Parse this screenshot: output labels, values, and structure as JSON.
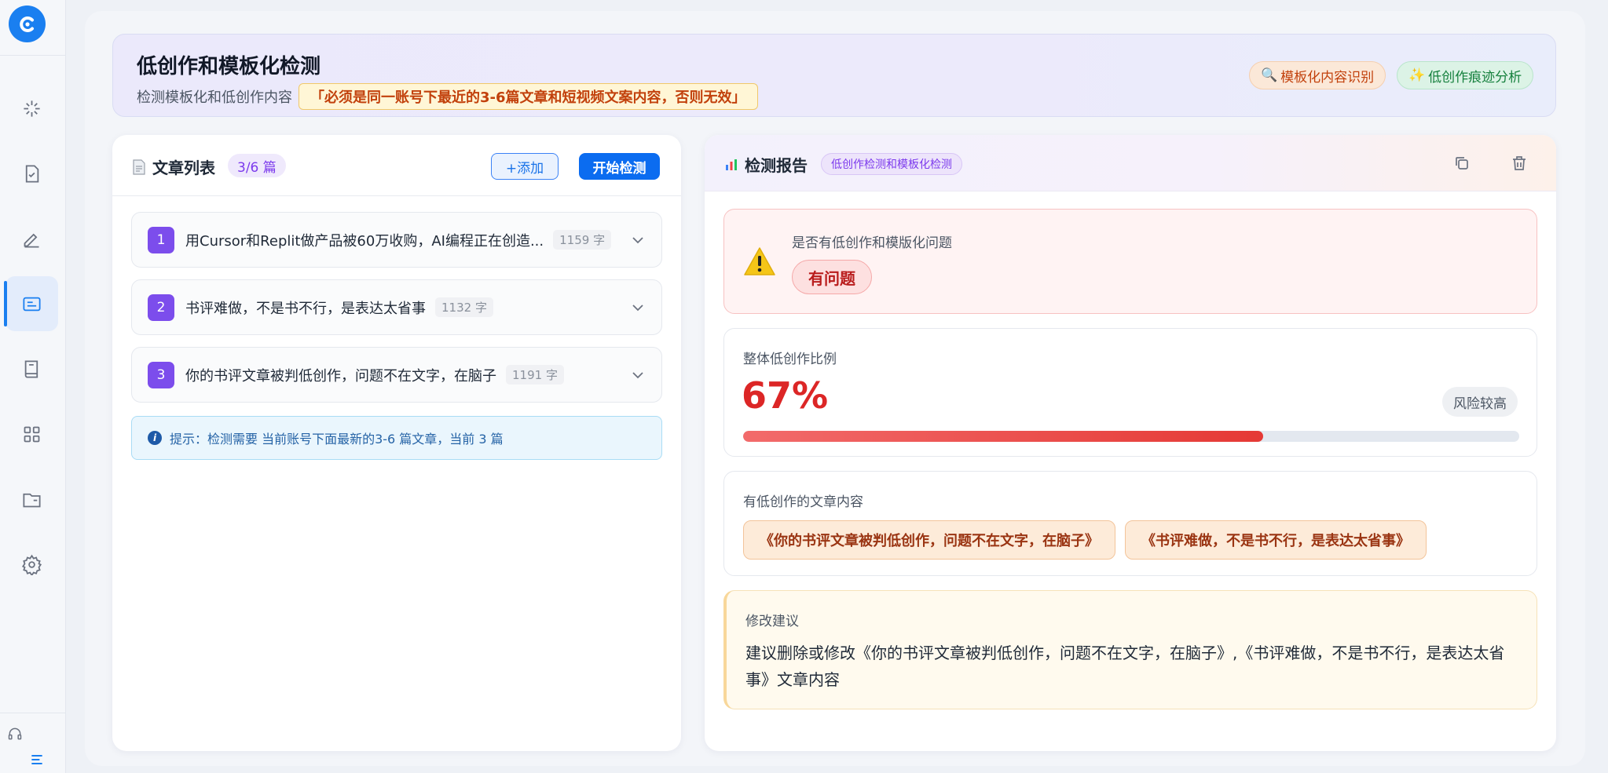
{
  "app": {
    "banner": {
      "title": "低创作和模板化检测",
      "subtitle": "检测模板化和低创作内容",
      "warning": "「必须是同一账号下最近的3-6篇文章和短视频文案内容，否则无效」",
      "chip_template": "模板化内容识别",
      "chip_low": "低创作痕迹分析"
    }
  },
  "left_panel": {
    "title": "文章列表",
    "count": "3/6 篇",
    "add_label": "+添加",
    "start_label": "开始检测",
    "articles": [
      {
        "num": "1",
        "title": "用Cursor和Replit做产品被60万收购，AI编程正在创造...",
        "words": "1159 字"
      },
      {
        "num": "2",
        "title": "书评难做，不是书不行，是表达太省事",
        "words": "1132 字"
      },
      {
        "num": "3",
        "title": "你的书评文章被判低创作，问题不在文字，在脑子",
        "words": "1191 字"
      }
    ],
    "tip": "提示：检测需要 当前账号下面最新的3-6 篇文章，当前 3 篇"
  },
  "right_panel": {
    "title": "检测报告",
    "tag": "低创作检测和模板化检测",
    "problem": {
      "label": "是否有低创作和模版化问题",
      "status": "有问题"
    },
    "ratio": {
      "label": "整体低创作比例",
      "value": "67%",
      "percent": 67,
      "risk": "风险较高"
    },
    "articles_card": {
      "label": "有低创作的文章内容",
      "items": [
        "《你的书评文章被判低创作，问题不在文字，在脑子》",
        "《书评难做，不是书不行，是表达太省事》"
      ]
    },
    "advice": {
      "label": "修改建议",
      "text": "建议删除或修改《你的书评文章被判低创作，问题不在文字，在脑子》,《书评难做，不是书不行，是表达太省事》文章内容"
    }
  },
  "colors": {
    "accent": "#1a7ff0",
    "danger": "#dc2626",
    "purple": "#7c4dec"
  }
}
